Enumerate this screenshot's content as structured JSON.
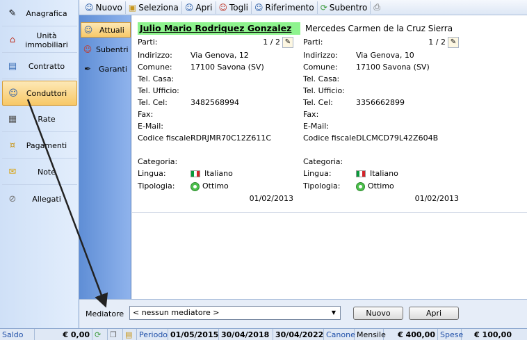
{
  "leftnav": {
    "items": [
      {
        "label": "Anagrafica",
        "icon": "✎"
      },
      {
        "label": "Unità immobiliari",
        "icon": "⌂"
      },
      {
        "label": "Contratto",
        "icon": "▤"
      },
      {
        "label": "Conduttori",
        "icon": "☺"
      },
      {
        "label": "Rate",
        "icon": "▦"
      },
      {
        "label": "Pagamenti",
        "icon": "¤"
      },
      {
        "label": "Note",
        "icon": "✉"
      },
      {
        "label": "Allegati",
        "icon": "⊘"
      }
    ]
  },
  "toolbar": {
    "nuovo": "Nuovo",
    "seleziona": "Seleziona",
    "apri": "Apri",
    "togli": "Togli",
    "riferimento": "Riferimento",
    "subentro": "Subentro"
  },
  "subnav": {
    "items": [
      {
        "label": "Attuali"
      },
      {
        "label": "Subentri"
      },
      {
        "label": "Garanti"
      }
    ]
  },
  "labels": {
    "parti": "Parti:",
    "indirizzo": "Indirizzo:",
    "comune": "Comune:",
    "tel_casa": "Tel. Casa:",
    "tel_ufficio": "Tel. Ufficio:",
    "tel_cel": "Tel. Cel:",
    "fax": "Fax:",
    "email": "E-Mail:",
    "codice_fiscale": "Codice fiscale:",
    "categoria": "Categoria:",
    "lingua": "Lingua:",
    "tipologia": "Tipologia:"
  },
  "tenants": [
    {
      "name": "Julio Mario Rodriquez Gonzalez",
      "parti": "1 / 2",
      "indirizzo": "Via Genova, 12",
      "comune": "17100 Savona (SV)",
      "tel_cel": "3482568994",
      "codice_fiscale": "RDRJMR70C12Z611C",
      "lingua": "Italiano",
      "tipologia": "Ottimo",
      "date": "01/02/2013"
    },
    {
      "name": "Mercedes Carmen de la Cruz Sierra",
      "parti": "1 / 2",
      "indirizzo": "Via Genova, 10",
      "comune": "17100 Savona (SV)",
      "tel_cel": "3356662899",
      "codice_fiscale": "DLCMCD79L42Z604B",
      "lingua": "Italiano",
      "tipologia": "Ottimo",
      "date": "01/02/2013"
    }
  ],
  "mediator": {
    "label": "Mediatore",
    "selected": "< nessun mediatore >",
    "nuovo": "Nuovo",
    "apri": "Apri"
  },
  "statusbar": {
    "saldo_label": "Saldo",
    "saldo_value": "€ 0,00",
    "periodo_label": "Periodo",
    "date1": "01/05/2015",
    "date2": "30/04/2018",
    "date3": "30/04/2022",
    "canone_label": "Canone",
    "mensile": "Mensile",
    "canone_value": "€ 400,00",
    "spese_label": "Spese",
    "spese_value": "€ 100,00"
  },
  "colors": {
    "highlight_name": "#8ef48e",
    "active_tab": "#f7c867",
    "subnav_blue": "#6a96dc"
  }
}
